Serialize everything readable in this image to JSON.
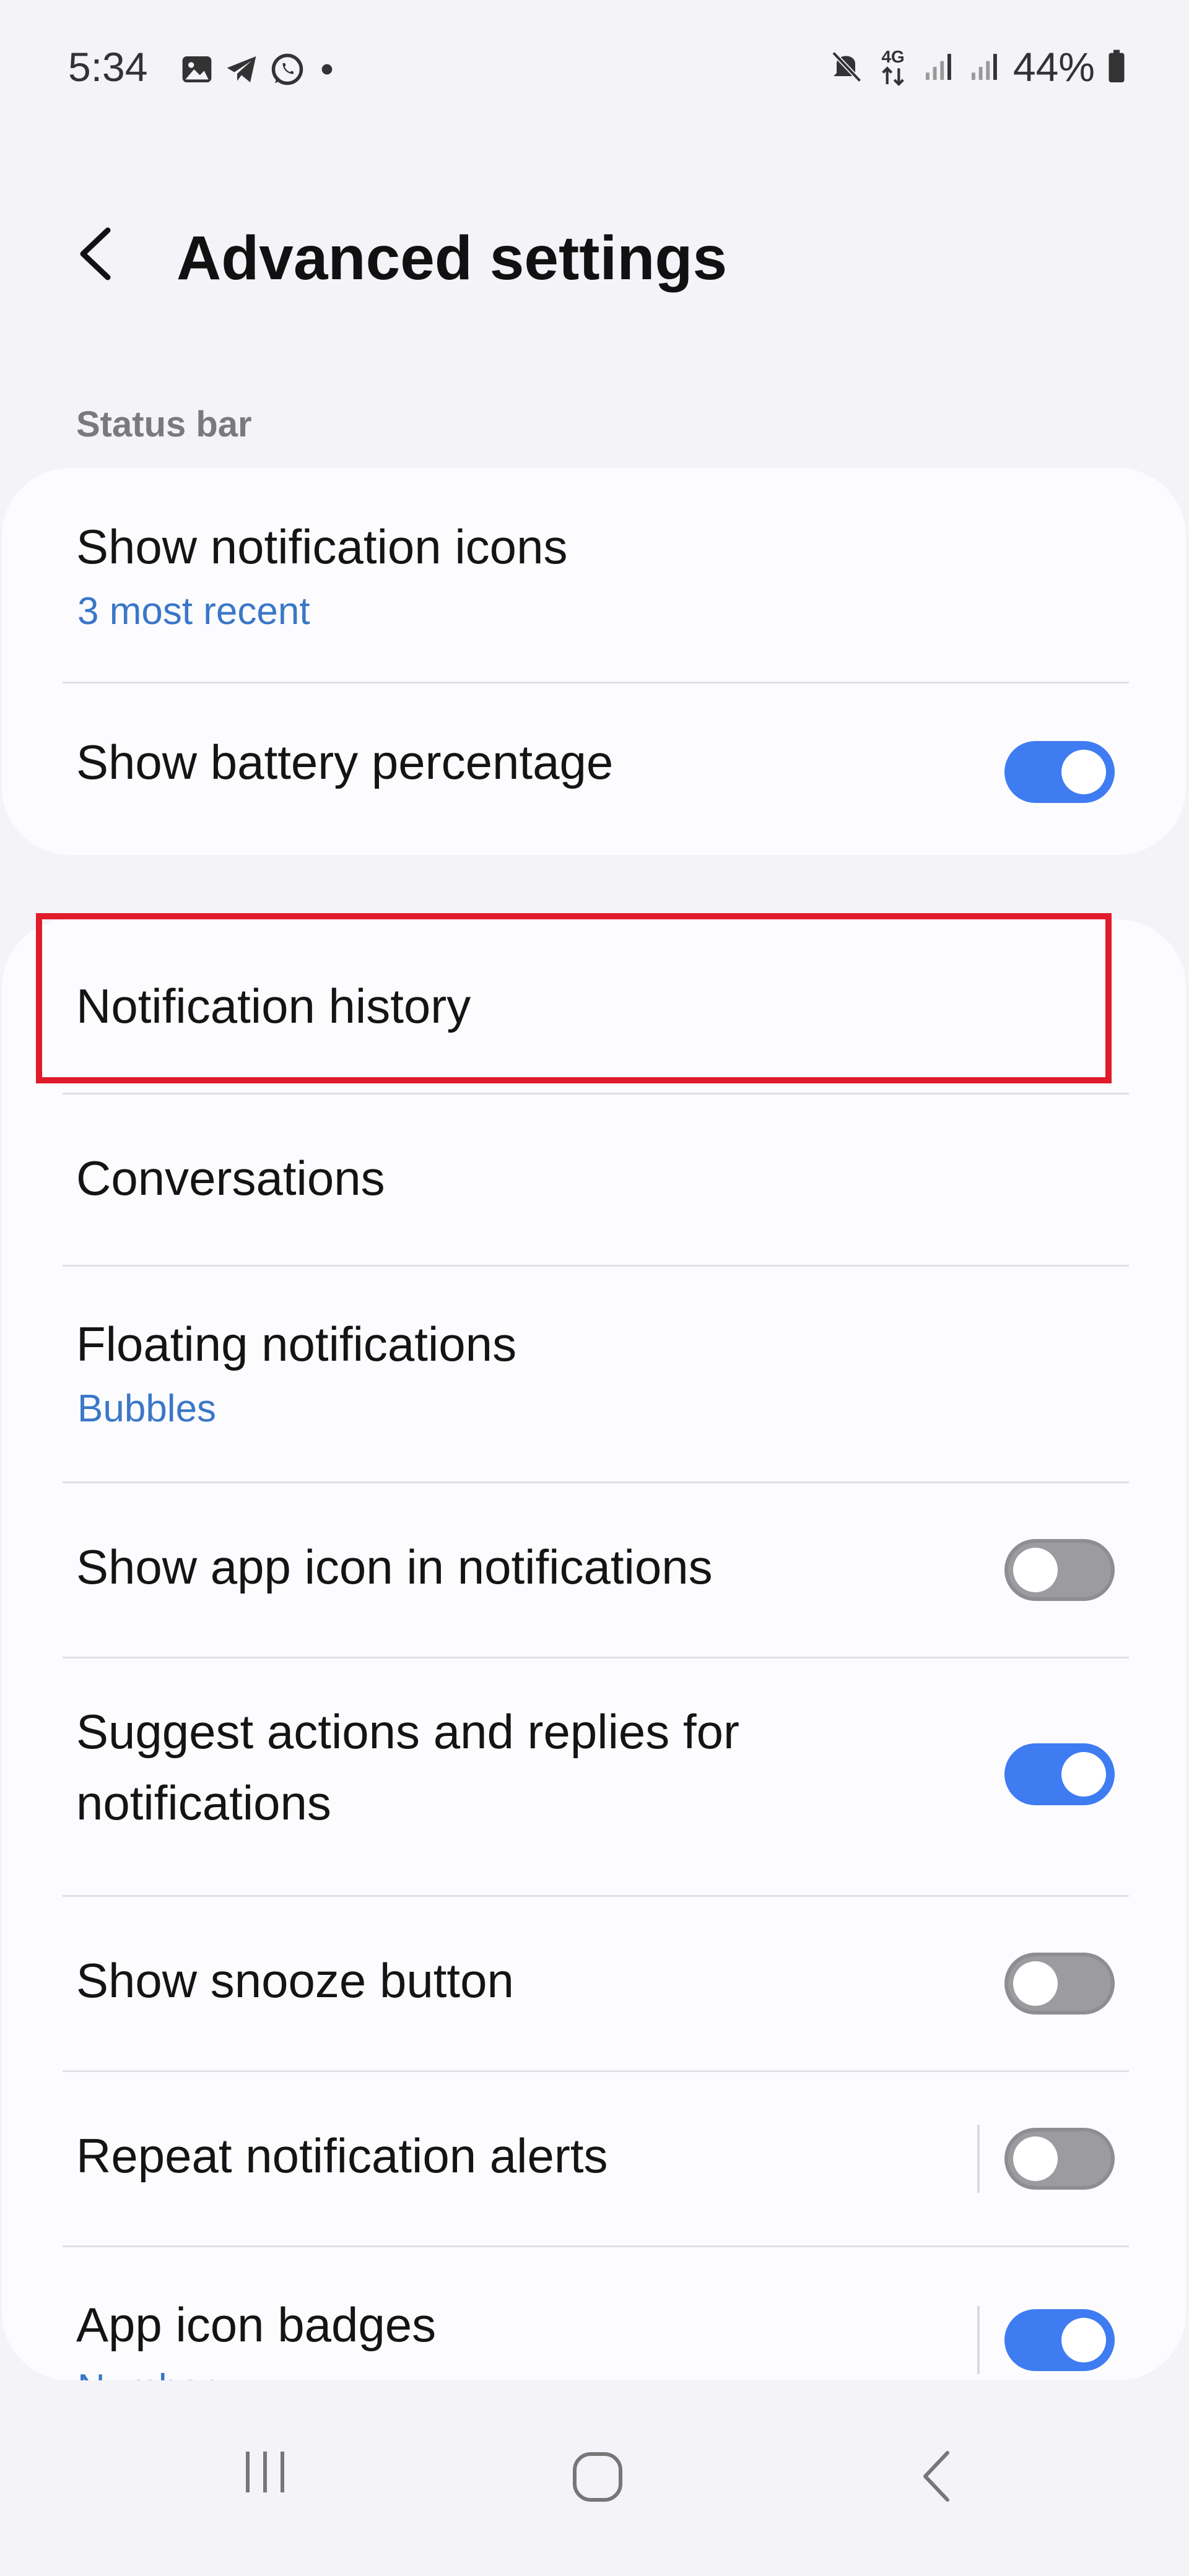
{
  "status_bar": {
    "time": "5:34",
    "left_icons": [
      "gallery-icon",
      "telegram-icon",
      "whatsapp-icon",
      "dot-icon"
    ],
    "right_icons": [
      "mute-icon",
      "4g-icon",
      "signal-icon",
      "signal-icon",
      "battery-icon"
    ],
    "network": "4G",
    "battery_percent": "44%"
  },
  "header": {
    "title": "Advanced settings"
  },
  "sections": {
    "status_bar_label": "Status bar"
  },
  "status_bar_card": {
    "notification_icons": {
      "title": "Show notification icons",
      "subtitle": "3 most recent"
    },
    "battery_percentage": {
      "title": "Show battery percentage",
      "toggle": "on"
    }
  },
  "notifications_card": {
    "items": [
      {
        "title": "Notification history"
      },
      {
        "title": "Conversations"
      },
      {
        "title": "Floating notifications",
        "subtitle": "Bubbles"
      },
      {
        "title": "Show app icon in notifications",
        "toggle": "off"
      },
      {
        "title_line1": "Suggest actions and replies for",
        "title_line2": "notifications",
        "toggle": "on"
      },
      {
        "title": "Show snooze button",
        "toggle": "off"
      },
      {
        "title": "Repeat notification alerts",
        "toggle": "off"
      },
      {
        "title": "App icon badges",
        "subtitle": "Number",
        "toggle": "on"
      }
    ]
  },
  "colors": {
    "accent": "#3f7cf2",
    "subtitle": "#3b77c7",
    "highlight": "#e01b2b",
    "background": "#f3f3f8",
    "card": "#fcfcff"
  },
  "nav_bar": {
    "icons": [
      "recent-apps-icon",
      "home-icon",
      "back-icon"
    ]
  }
}
